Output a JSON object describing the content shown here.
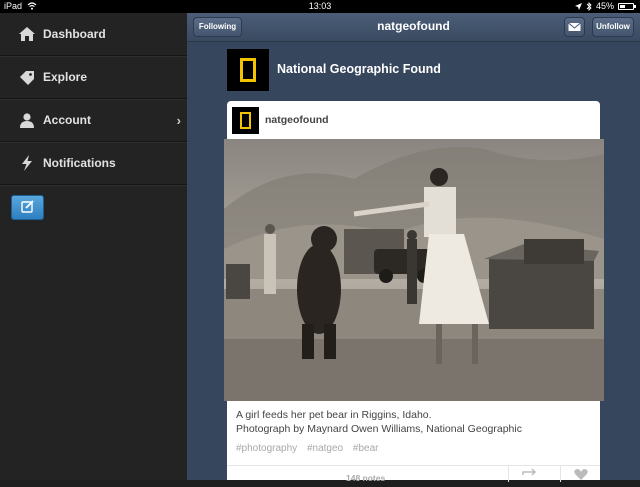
{
  "status_bar": {
    "device": "iPad",
    "time": "13:03",
    "battery_text": "45%",
    "battery_level": 0.45
  },
  "sidebar": {
    "items": [
      {
        "label": "Dashboard",
        "icon": "home-icon"
      },
      {
        "label": "Explore",
        "icon": "tag-icon"
      },
      {
        "label": "Account",
        "icon": "person-icon",
        "has_chevron": true,
        "chevron": "›"
      },
      {
        "label": "Notifications",
        "icon": "lightning-icon"
      }
    ],
    "compose_icon": "compose-icon"
  },
  "header": {
    "title": "natgeofound",
    "following_label": "Following",
    "unfollow_label": "Unfollow",
    "mail_icon": "mail-icon"
  },
  "blog": {
    "name": "National Geographic Found",
    "accent": "#f5c400"
  },
  "post": {
    "username": "natgeofound",
    "caption_line1": "A girl feeds her pet bear in Riggins, Idaho.",
    "caption_line2": "Photograph by Maynard Owen Williams, National Geographic",
    "tags": [
      "#photography",
      "#natgeo",
      "#bear"
    ],
    "notes": "148 notes"
  },
  "colors": {
    "sidebar_bg": "#232323",
    "main_bg": "#36465d",
    "compose_blue": "#3b8fd0"
  }
}
